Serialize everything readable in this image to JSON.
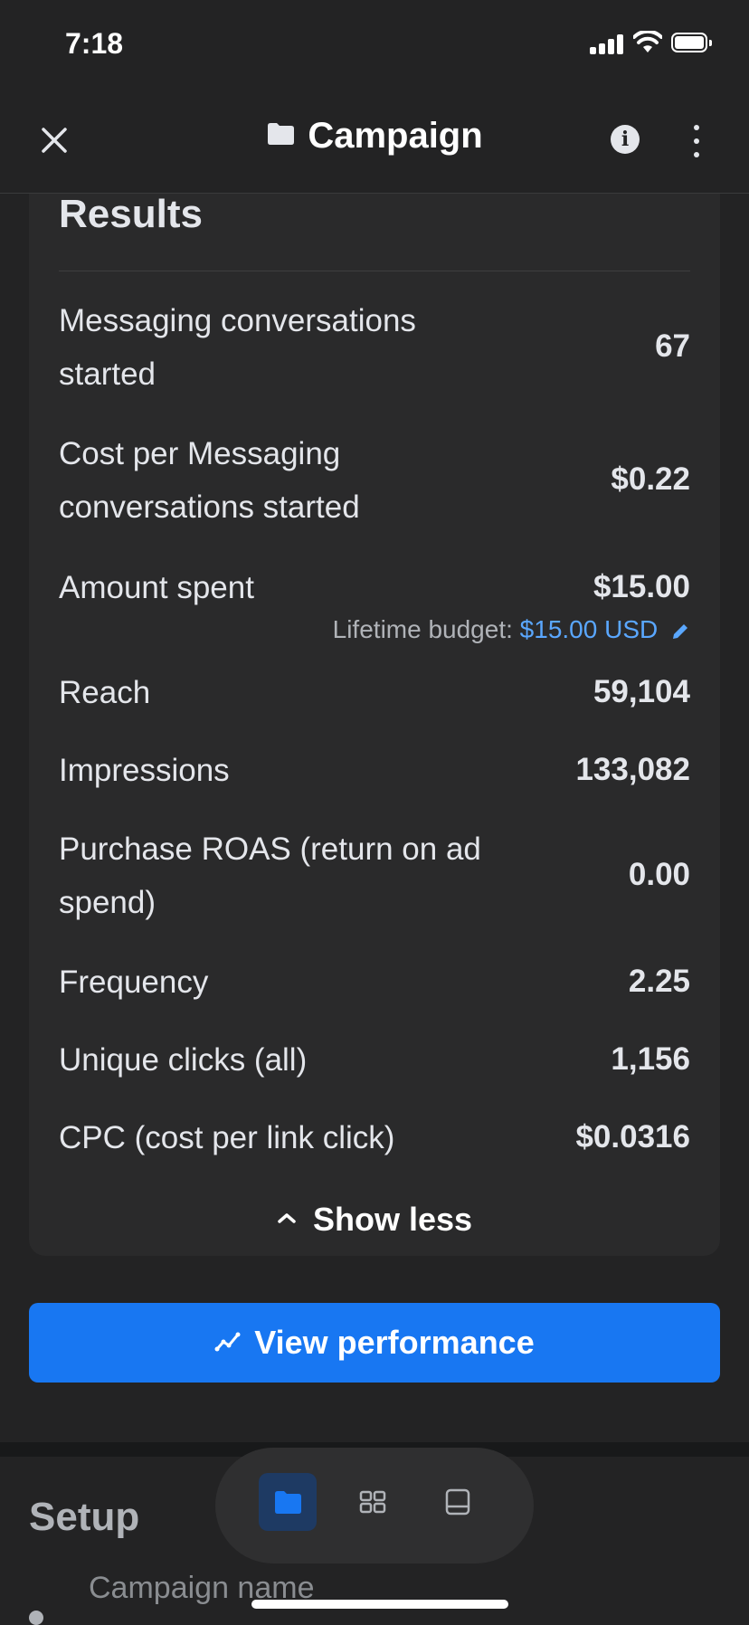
{
  "status_bar": {
    "time": "7:18"
  },
  "nav": {
    "title": "Campaign",
    "icons": [
      "close-icon",
      "folder-icon",
      "info-icon",
      "more-icon"
    ]
  },
  "results": {
    "title": "Results",
    "rows": [
      {
        "label": "Messaging conversations started",
        "value": "67"
      },
      {
        "label": "Cost per Messaging conversations started",
        "value": "$0.22"
      },
      {
        "label": "Amount spent",
        "value": "$15.00"
      },
      {
        "label": "Reach",
        "value": "59,104"
      },
      {
        "label": "Impressions",
        "value": "133,082"
      },
      {
        "label": "Purchase ROAS (return on ad spend)",
        "value": "0.00"
      },
      {
        "label": "Frequency",
        "value": "2.25"
      },
      {
        "label": "Unique clicks (all)",
        "value": "1,156"
      },
      {
        "label": "CPC (cost per link click)",
        "value": "$0.0316"
      }
    ],
    "budget_label": "Lifetime budget:",
    "budget_value": "$15.00 USD",
    "show_less": "Show less"
  },
  "view_performance": "View performance",
  "setup": {
    "title": "Setup",
    "campaign_name_label": "Campaign name"
  },
  "tabbar": {
    "icons": [
      "folder-icon",
      "grid-icon",
      "ad-preview-icon"
    ],
    "active": 0
  },
  "colors": {
    "accent": "#1877f2",
    "link": "#5aa7ff",
    "background": "#232324",
    "card": "#2a2a2b"
  }
}
